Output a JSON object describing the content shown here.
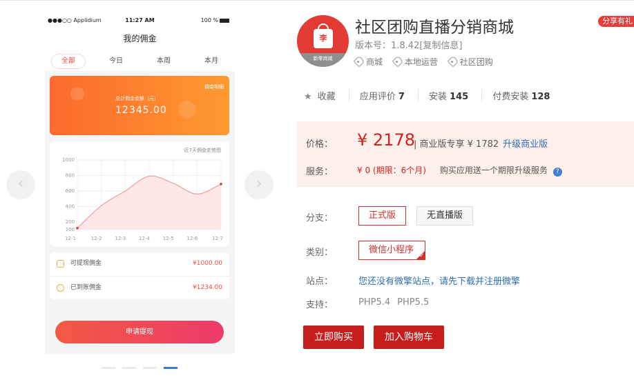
{
  "phone": {
    "carrier": "●●●○○ Applidium",
    "time": "11:27 AM",
    "battery": "100 %",
    "title": "我的佣金",
    "tabs": [
      {
        "label": "全部",
        "active": true
      },
      {
        "label": "今日",
        "active": false
      },
      {
        "label": "本周",
        "active": false
      },
      {
        "label": "本月",
        "active": false
      }
    ],
    "commission_card": {
      "detail_link": "佣金明细",
      "label": "总计佣金金额（元）",
      "amount": "12345.00"
    },
    "chart_title": "近7天佣金走势图",
    "withdrawable": {
      "label": "可提现佣金",
      "value": "¥1000.00"
    },
    "received": {
      "label": "已到账佣金",
      "value": "¥1234.00"
    },
    "apply_button": "申请提现"
  },
  "chart_data": {
    "type": "area",
    "categories": [
      "12-1",
      "12-2",
      "12-3",
      "12-4",
      "12-5",
      "12-6",
      "12-7"
    ],
    "values": [
      120,
      410,
      600,
      790,
      700,
      560,
      690
    ],
    "yticks": [
      1000,
      800,
      600,
      400,
      200,
      100
    ],
    "ylim": [
      100,
      1000
    ],
    "line_color": "#f2a3a3",
    "fill_color": "#fde7e7",
    "title": "近7天佣金走势图",
    "xlabel": "",
    "ylabel": "",
    "grid": true
  },
  "gallery": {
    "prev_icon": "chevron-left-icon",
    "next_icon": "chevron-right-icon",
    "prev_glyph": "‹",
    "next_glyph": "›",
    "page_count": 4,
    "active_page": 4
  },
  "product": {
    "logo_text": "新零商城",
    "logo_badge": "李",
    "title": "社区团购直播分销商城",
    "share_badge": "分享有礼",
    "version_label": "版本号：1.8.42",
    "copy_info": "[复制信息]",
    "tags": [
      "商城",
      "本地运营",
      "社区团购"
    ]
  },
  "stats": {
    "favorite": "收藏",
    "rating_label": "应用评价",
    "rating_value": "7",
    "install_label": "安装",
    "install_value": "145",
    "paid_label": "付费安装",
    "paid_value": "128"
  },
  "pricing": {
    "price_label": "价格：",
    "price": "¥ 2178",
    "business_text": "| 商业版专享 ¥ 1782",
    "upgrade_link": "升级商业版",
    "service_label": "服务：",
    "service_value": "¥ 0 (期限：6个月)",
    "service_free": "购买应用送一个期限升级服务",
    "help_icon": "?"
  },
  "options": {
    "branch_label": "分支：",
    "branches": [
      {
        "label": "正式版",
        "selected": true
      },
      {
        "label": "无直播版",
        "selected": false
      }
    ],
    "category_label": "类别：",
    "category": "微信小程序",
    "site_label": "站点：",
    "site_text": "您还没有微擎站点，请先下载并注册微擎",
    "support_label": "支持：",
    "support": [
      "PHP5.4",
      "PHP5.5"
    ]
  },
  "actions": {
    "buy": "立即购买",
    "cart": "加入购物车"
  },
  "colors": {
    "brand_red": "#c81d1d",
    "price_red": "#d71f1f",
    "link_blue": "#2d6db5",
    "price_bg": "#fdf0ea"
  }
}
